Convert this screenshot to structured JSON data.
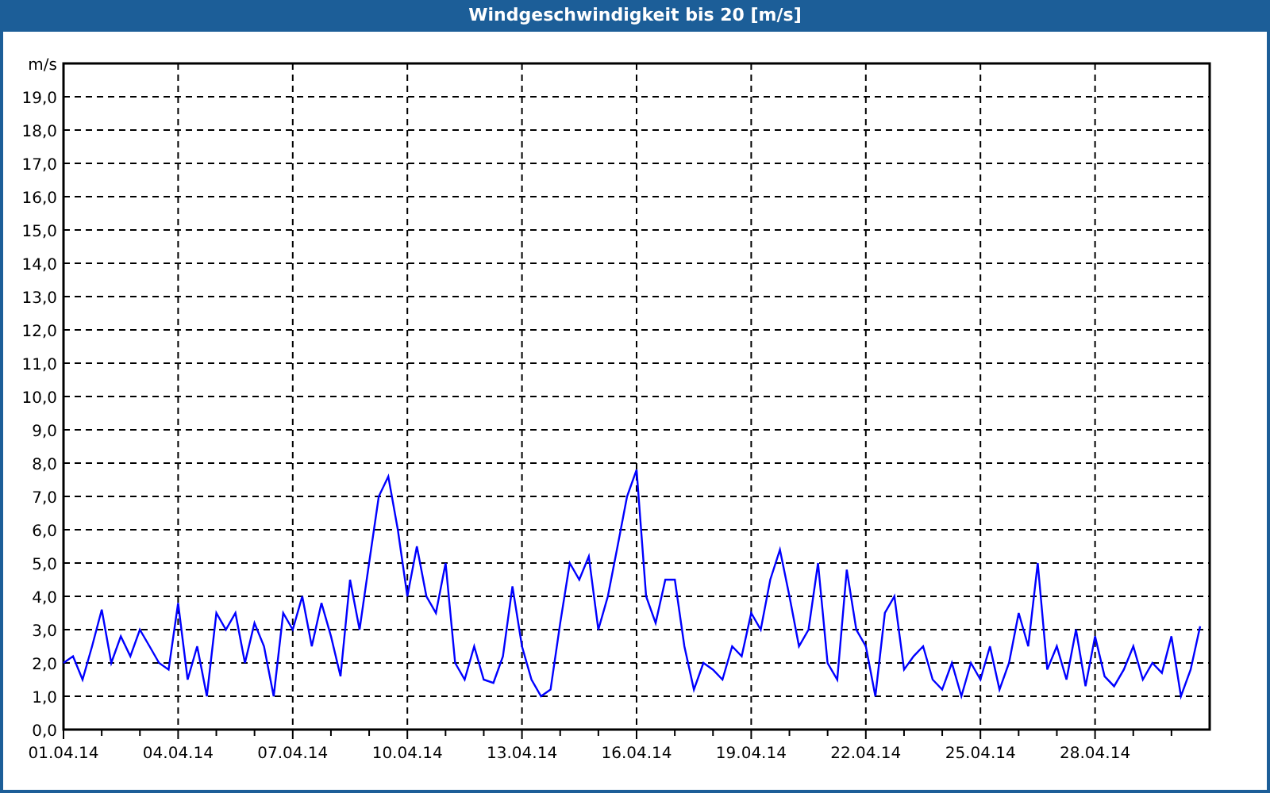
{
  "window": {
    "title": "Windgeschwindigkeit bis 20 [m/s]"
  },
  "chart": {
    "chart_data": {
      "type": "line",
      "grid": true,
      "ylabel": "m/s",
      "ylim": [
        0,
        20
      ],
      "yticks": [
        {
          "value": 0,
          "label": "0,0"
        },
        {
          "value": 1,
          "label": "1,0"
        },
        {
          "value": 2,
          "label": "2,0"
        },
        {
          "value": 3,
          "label": "3,0"
        },
        {
          "value": 4,
          "label": "4,0"
        },
        {
          "value": 5,
          "label": "5,0"
        },
        {
          "value": 6,
          "label": "6,0"
        },
        {
          "value": 7,
          "label": "7,0"
        },
        {
          "value": 8,
          "label": "8,0"
        },
        {
          "value": 9,
          "label": "9,0"
        },
        {
          "value": 10,
          "label": "10,0"
        },
        {
          "value": 11,
          "label": "11,0"
        },
        {
          "value": 12,
          "label": "12,0"
        },
        {
          "value": 13,
          "label": "13,0"
        },
        {
          "value": 14,
          "label": "14,0"
        },
        {
          "value": 15,
          "label": "15,0"
        },
        {
          "value": 16,
          "label": "16,0"
        },
        {
          "value": 17,
          "label": "17,0"
        },
        {
          "value": 18,
          "label": "18,0"
        },
        {
          "value": 19,
          "label": "19,0"
        }
      ],
      "categories": [
        "01.04.14",
        null,
        null,
        null,
        null,
        null,
        null,
        null,
        null,
        null,
        null,
        null,
        "04.04.14",
        null,
        null,
        null,
        null,
        null,
        null,
        null,
        null,
        null,
        null,
        null,
        "07.04.14",
        null,
        null,
        null,
        null,
        null,
        null,
        null,
        null,
        null,
        null,
        null,
        "10.04.14",
        null,
        null,
        null,
        null,
        null,
        null,
        null,
        null,
        null,
        null,
        null,
        "13.04.14",
        null,
        null,
        null,
        null,
        null,
        null,
        null,
        null,
        null,
        null,
        null,
        "16.04.14",
        null,
        null,
        null,
        null,
        null,
        null,
        null,
        null,
        null,
        null,
        null,
        "19.04.14",
        null,
        null,
        null,
        null,
        null,
        null,
        null,
        null,
        null,
        null,
        null,
        "22.04.14",
        null,
        null,
        null,
        null,
        null,
        null,
        null,
        null,
        null,
        null,
        null,
        "25.04.14",
        null,
        null,
        null,
        null,
        null,
        null,
        null,
        null,
        null,
        null,
        null,
        "28.04.14",
        null,
        null,
        null,
        null,
        null,
        null,
        null,
        null,
        null,
        null,
        null
      ],
      "series": [
        {
          "color": "#0000ff",
          "values": [
            2.0,
            2.2,
            1.5,
            2.5,
            3.6,
            2.0,
            2.8,
            2.2,
            3.0,
            2.5,
            2.0,
            1.8,
            3.8,
            1.5,
            2.5,
            1.0,
            3.5,
            3.0,
            3.5,
            2.0,
            3.2,
            2.5,
            1.0,
            3.5,
            3.0,
            4.0,
            2.5,
            3.8,
            2.8,
            1.6,
            4.5,
            3.0,
            5.0,
            7.0,
            7.6,
            6.0,
            4.0,
            5.5,
            4.0,
            3.5,
            5.0,
            2.0,
            1.5,
            2.5,
            1.5,
            1.4,
            2.2,
            4.3,
            2.5,
            1.5,
            1.0,
            1.2,
            3.2,
            5.0,
            4.5,
            5.2,
            3.0,
            4.0,
            5.5,
            7.0,
            7.8,
            4.0,
            3.2,
            4.5,
            4.5,
            2.5,
            1.2,
            2.0,
            1.8,
            1.5,
            2.5,
            2.2,
            3.5,
            3.0,
            4.5,
            5.4,
            4.0,
            2.5,
            3.0,
            5.0,
            2.0,
            1.5,
            4.8,
            3.0,
            2.5,
            1.0,
            3.5,
            4.0,
            1.8,
            2.2,
            2.5,
            1.5,
            1.2,
            2.0,
            1.0,
            2.0,
            1.5,
            2.5,
            1.2,
            2.0,
            3.5,
            2.5,
            5.0,
            1.8,
            2.5,
            1.5,
            3.0,
            1.3,
            2.8,
            1.6,
            1.3,
            1.8,
            2.5,
            1.5,
            2.0,
            1.7,
            2.8,
            1.0,
            1.8,
            3.1
          ]
        }
      ]
    }
  }
}
